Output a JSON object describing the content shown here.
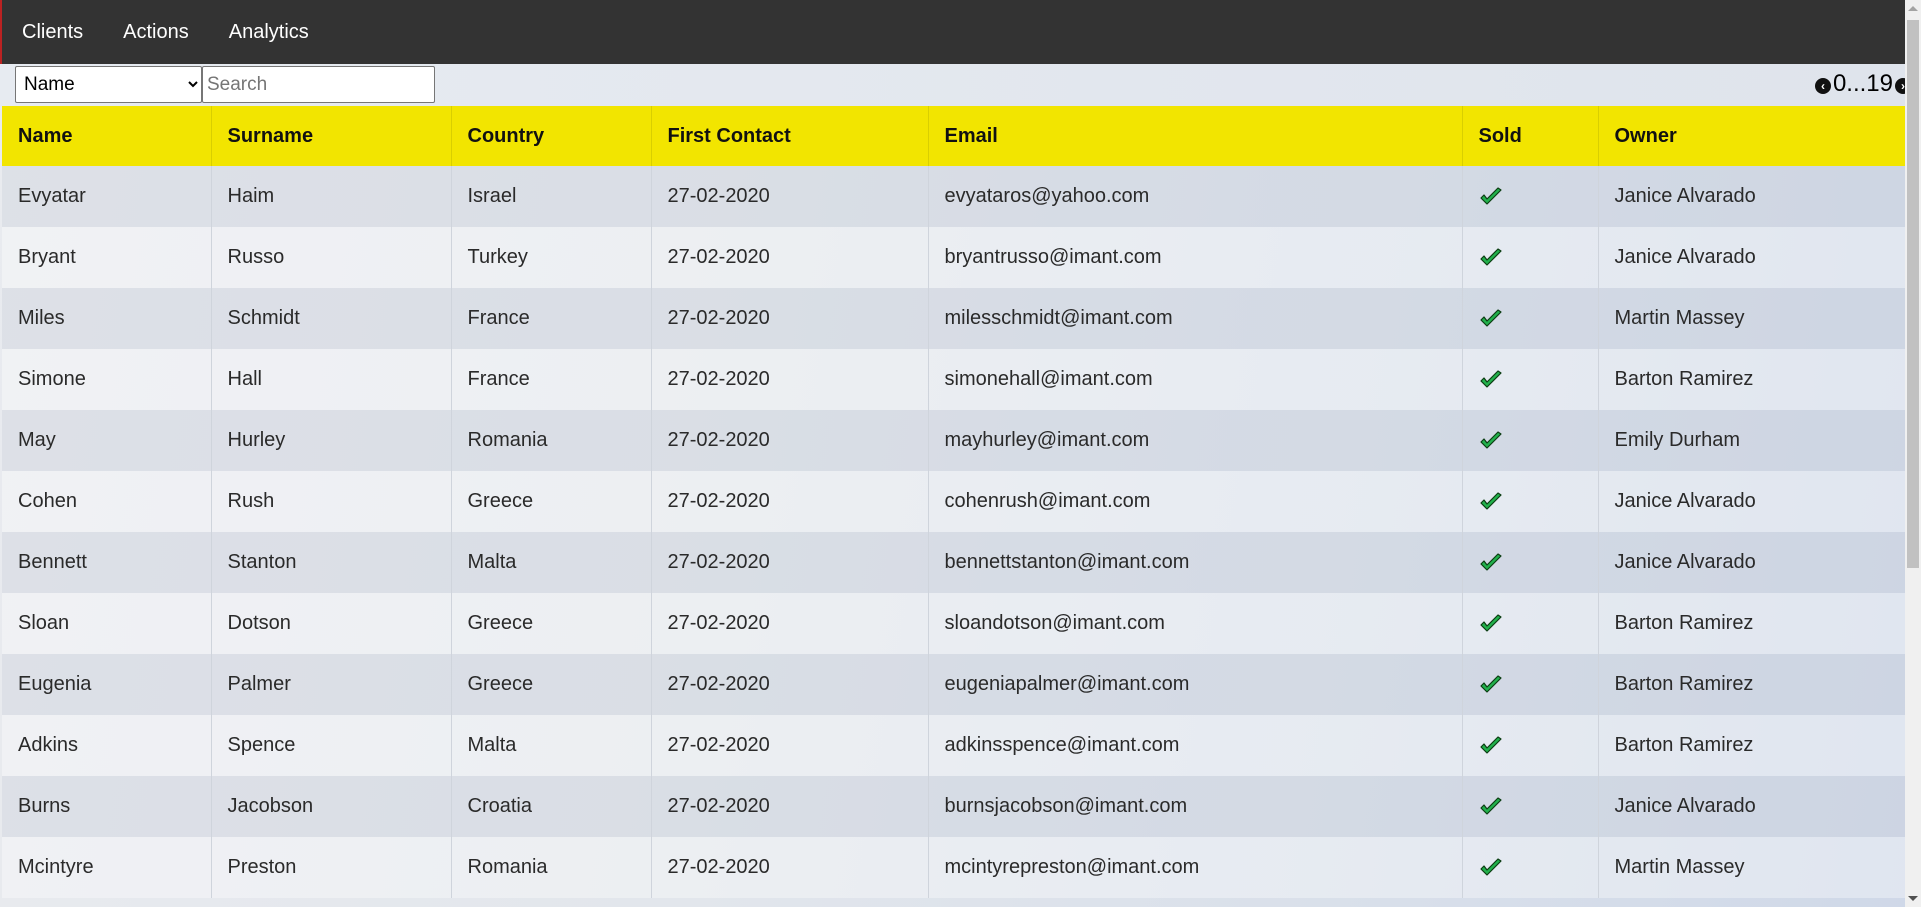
{
  "nav": {
    "items": [
      "Clients",
      "Actions",
      "Analytics"
    ]
  },
  "filter": {
    "selected_field": "Name",
    "search_placeholder": "Search",
    "search_value": ""
  },
  "pager": {
    "range_text": "0...19"
  },
  "table": {
    "columns": [
      "Name",
      "Surname",
      "Country",
      "First Contact",
      "Email",
      "Sold",
      "Owner"
    ],
    "rows": [
      {
        "name": "Evyatar",
        "surname": "Haim",
        "country": "Israel",
        "first_contact": "27-02-2020",
        "email": "evyataros@yahoo.com",
        "sold": true,
        "owner": "Janice Alvarado"
      },
      {
        "name": "Bryant",
        "surname": "Russo",
        "country": "Turkey",
        "first_contact": "27-02-2020",
        "email": "bryantrusso@imant.com",
        "sold": true,
        "owner": "Janice Alvarado"
      },
      {
        "name": "Miles",
        "surname": "Schmidt",
        "country": "France",
        "first_contact": "27-02-2020",
        "email": "milesschmidt@imant.com",
        "sold": true,
        "owner": "Martin Massey"
      },
      {
        "name": "Simone",
        "surname": "Hall",
        "country": "France",
        "first_contact": "27-02-2020",
        "email": "simonehall@imant.com",
        "sold": true,
        "owner": "Barton Ramirez"
      },
      {
        "name": "May",
        "surname": "Hurley",
        "country": "Romania",
        "first_contact": "27-02-2020",
        "email": "mayhurley@imant.com",
        "sold": true,
        "owner": "Emily Durham"
      },
      {
        "name": "Cohen",
        "surname": "Rush",
        "country": "Greece",
        "first_contact": "27-02-2020",
        "email": "cohenrush@imant.com",
        "sold": true,
        "owner": "Janice Alvarado"
      },
      {
        "name": "Bennett",
        "surname": "Stanton",
        "country": "Malta",
        "first_contact": "27-02-2020",
        "email": "bennettstanton@imant.com",
        "sold": true,
        "owner": "Janice Alvarado"
      },
      {
        "name": "Sloan",
        "surname": "Dotson",
        "country": "Greece",
        "first_contact": "27-02-2020",
        "email": "sloandotson@imant.com",
        "sold": true,
        "owner": "Barton Ramirez"
      },
      {
        "name": "Eugenia",
        "surname": "Palmer",
        "country": "Greece",
        "first_contact": "27-02-2020",
        "email": "eugeniapalmer@imant.com",
        "sold": true,
        "owner": "Barton Ramirez"
      },
      {
        "name": "Adkins",
        "surname": "Spence",
        "country": "Malta",
        "first_contact": "27-02-2020",
        "email": "adkinsspence@imant.com",
        "sold": true,
        "owner": "Barton Ramirez"
      },
      {
        "name": "Burns",
        "surname": "Jacobson",
        "country": "Croatia",
        "first_contact": "27-02-2020",
        "email": "burnsjacobson@imant.com",
        "sold": true,
        "owner": "Janice Alvarado"
      },
      {
        "name": "Mcintyre",
        "surname": "Preston",
        "country": "Romania",
        "first_contact": "27-02-2020",
        "email": "mcintyrepreston@imant.com",
        "sold": true,
        "owner": "Martin Massey"
      }
    ]
  },
  "colors": {
    "navbar_bg": "#333333",
    "header_bg": "#f2e500",
    "check_green": "#22b14c"
  },
  "icons": {
    "sold_true": "check-icon",
    "pager_prev": "chevron-left-icon",
    "pager_next": "chevron-right-icon"
  }
}
